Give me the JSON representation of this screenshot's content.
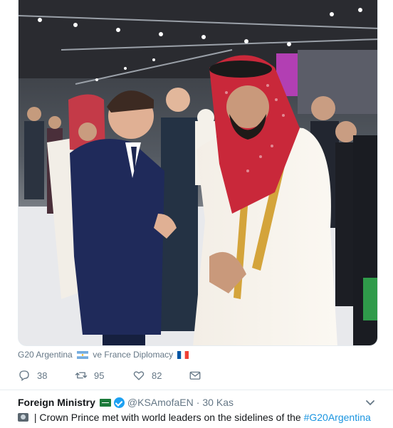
{
  "photo": {
    "alt": "Two leaders speaking at an event"
  },
  "tagline": {
    "text_a": "G20 Argentina",
    "text_b": "ve France Diplomacy"
  },
  "actions": {
    "reply_count": "38",
    "retweet_count": "95",
    "like_count": "82"
  },
  "tweet": {
    "author_name": "Foreign Ministry",
    "handle": "@KSAmofaEN",
    "separator": "·",
    "date": "30 Kas",
    "text_prefix": " | Crown Prince met with world leaders on the sidelines of the ",
    "hashtag": "#G20Argentina"
  },
  "colors": {
    "link": "#1b95e0",
    "muted": "#657786",
    "border": "#e6ecf0"
  }
}
